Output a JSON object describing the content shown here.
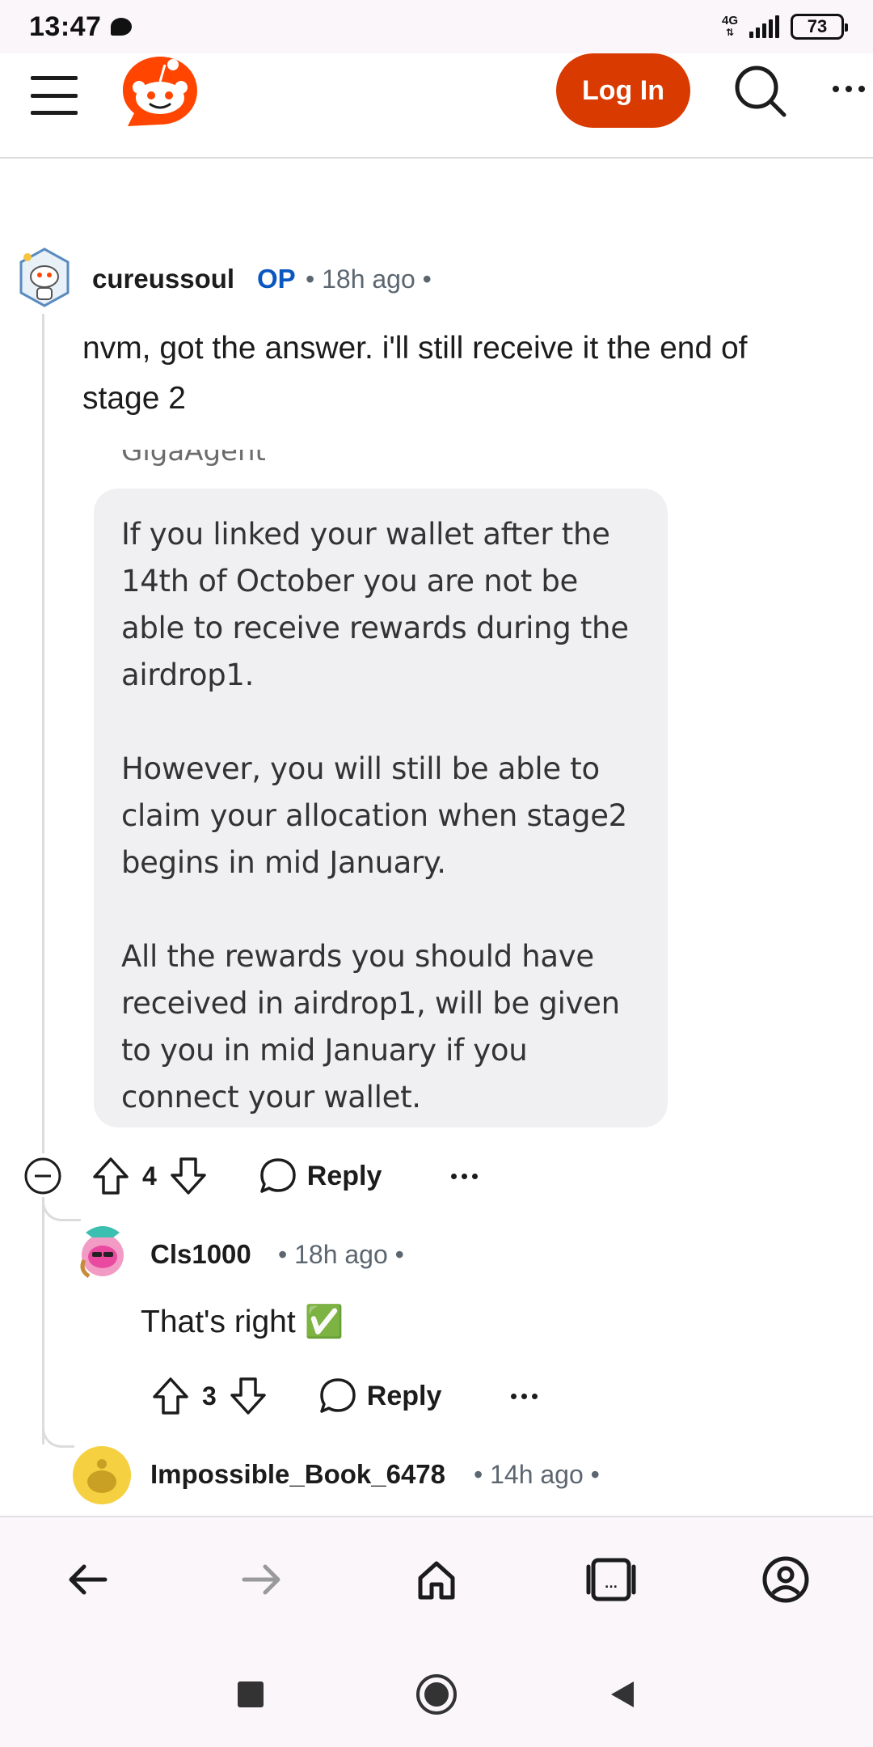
{
  "status_bar": {
    "time": "13:47",
    "network": "4G",
    "battery": "73"
  },
  "header": {
    "login_label": "Log In",
    "icons": [
      "menu-icon",
      "reddit-logo",
      "search-icon",
      "more-icon"
    ]
  },
  "comments": [
    {
      "author": "cureussoul",
      "op_label": "OP",
      "time": "• 18h ago •",
      "text": "nvm, got the answer. i'll still receive it the end of stage 2",
      "quoted_image": {
        "sender": "GigaAgent",
        "paragraphs": [
          "If you linked your wallet after the 14th of October you are not be able to receive rewards during the airdrop1.",
          "However, you will still be able to claim your allocation when stage2 begins in mid January.",
          "All the rewards you should have received in airdrop1, will be given to you in mid January if you connect your wallet."
        ]
      },
      "votes": "4",
      "reply_label": "Reply"
    },
    {
      "author": "Cls1000",
      "time": "• 18h ago •",
      "text": "That's right ✅",
      "votes": "3",
      "reply_label": "Reply"
    },
    {
      "author": "Impossible_Book_6478",
      "time": "• 14h ago •"
    }
  ],
  "browser_nav": [
    "back-icon",
    "forward-icon",
    "home-icon",
    "tabs-icon",
    "account-icon"
  ],
  "system_nav": [
    "recents-icon",
    "home-circle-icon",
    "back-triangle-icon"
  ],
  "colors": {
    "brand": "#ff4500",
    "login_button": "#d93a00",
    "op_blue": "#0a57c2",
    "meta_gray": "#5c6670"
  }
}
